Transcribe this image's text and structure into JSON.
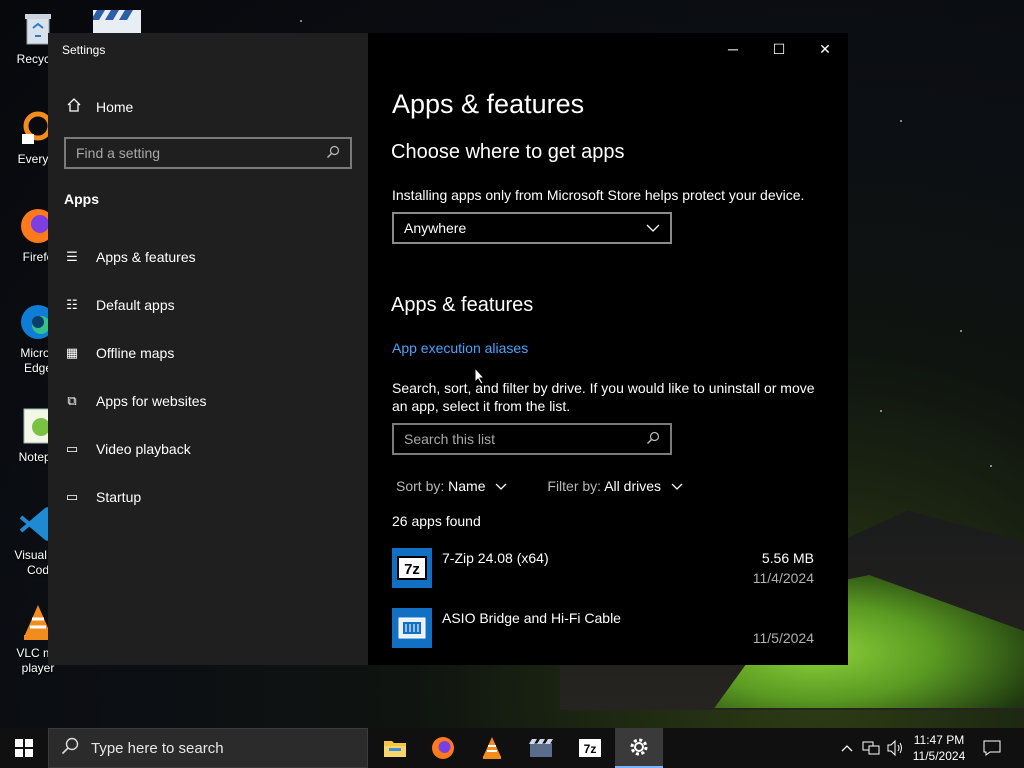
{
  "desktop": {
    "icons": [
      {
        "label": "Recycle",
        "icon": "recycle-bin-icon"
      },
      {
        "label": "Everyth",
        "icon": "everything-icon"
      },
      {
        "label": "Firefo",
        "icon": "firefox-icon"
      },
      {
        "label": "Micros Edge",
        "icon": "edge-icon"
      },
      {
        "label": "Notepa",
        "icon": "notepad-icon"
      },
      {
        "label": "Visual St Cod",
        "icon": "vscode-icon"
      },
      {
        "label": "VLC me player",
        "icon": "vlc-icon"
      }
    ]
  },
  "window": {
    "title": "Settings",
    "controls": {
      "minimize": "─",
      "maximize": "☐",
      "close": "✕"
    }
  },
  "nav": {
    "home_label": "Home",
    "search_placeholder": "Find a setting",
    "section": "Apps",
    "items": [
      {
        "label": "Apps & features",
        "icon": "apps-features-icon",
        "glyph": "☰"
      },
      {
        "label": "Default apps",
        "icon": "default-apps-icon",
        "glyph": "☷"
      },
      {
        "label": "Offline maps",
        "icon": "offline-maps-icon",
        "glyph": "▦"
      },
      {
        "label": "Apps for websites",
        "icon": "apps-websites-icon",
        "glyph": "⧉"
      },
      {
        "label": "Video playback",
        "icon": "video-playback-icon",
        "glyph": "▭"
      },
      {
        "label": "Startup",
        "icon": "startup-icon",
        "glyph": "▭"
      }
    ]
  },
  "content": {
    "page_title": "Apps & features",
    "choose_heading": "Choose where to get apps",
    "choose_desc": "Installing apps only from Microsoft Store helps protect your device.",
    "source_dropdown": {
      "selected": "Anywhere"
    },
    "apps_heading": "Apps & features",
    "aliases_link": "App execution aliases",
    "list_desc": "Search, sort, and filter by drive. If you would like to uninstall or move an app, select it from the list.",
    "list_search_placeholder": "Search this list",
    "sort": {
      "label": "Sort by:",
      "value": "Name"
    },
    "filter": {
      "label": "Filter by:",
      "value": "All drives"
    },
    "count": "26 apps found",
    "apps": [
      {
        "name": "7-Zip 24.08 (x64)",
        "size": "5.56 MB",
        "date": "11/4/2024",
        "icon": "7zip-icon"
      },
      {
        "name": "ASIO Bridge and Hi-Fi Cable",
        "size": "",
        "date": "11/5/2024",
        "icon": "asio-bridge-icon"
      }
    ]
  },
  "taskbar": {
    "search_placeholder": "Type here to search",
    "apps": [
      {
        "name": "file-explorer-icon"
      },
      {
        "name": "firefox-icon"
      },
      {
        "name": "vlc-icon"
      },
      {
        "name": "clapper-icon"
      },
      {
        "name": "7zip-icon"
      },
      {
        "name": "settings-gear-icon",
        "active": true
      }
    ],
    "clock": {
      "time": "11:47 PM",
      "date": "11/5/2024"
    }
  },
  "colors": {
    "accent": "#4aa3ff",
    "app_tile": "#1170c4",
    "nav_bg": "#1f1f1f",
    "content_bg": "#000000"
  }
}
